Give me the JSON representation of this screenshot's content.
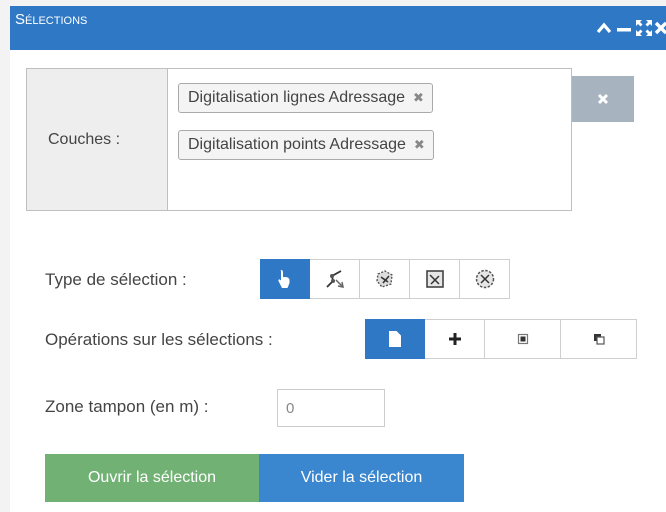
{
  "window": {
    "title": "Sélections",
    "controls": [
      "collapse-icon",
      "minimize-icon",
      "expand-icon",
      "close-icon"
    ]
  },
  "layers": {
    "label": "Couches :",
    "selected": [
      {
        "name": "Digitalisation lignes Adressage",
        "remove": "✖"
      },
      {
        "name": "Digitalisation points Adressage",
        "remove": "✖"
      }
    ],
    "clear_icon": "close-icon"
  },
  "selection_type": {
    "label": "Type de sélection :",
    "options": [
      "select-pointer-icon",
      "select-line-icon",
      "select-polygon-icon",
      "select-rectangle-icon",
      "select-circle-icon"
    ],
    "active_index": 0
  },
  "operations": {
    "label": "Opérations sur les sélections :",
    "options": [
      "new-selection-icon",
      "add-selection-icon",
      "intersect-selection-icon",
      "subtract-selection-icon"
    ],
    "active_index": 0
  },
  "buffer": {
    "label": "Zone tampon (en m) :",
    "value": "0"
  },
  "actions": {
    "open_label": "Ouvrir la sélection",
    "clear_label": "Vider la sélection"
  },
  "colors": {
    "primary": "#2e78c6",
    "open_button": "#71b274",
    "clear_layers_button": "#a7b4bf"
  }
}
